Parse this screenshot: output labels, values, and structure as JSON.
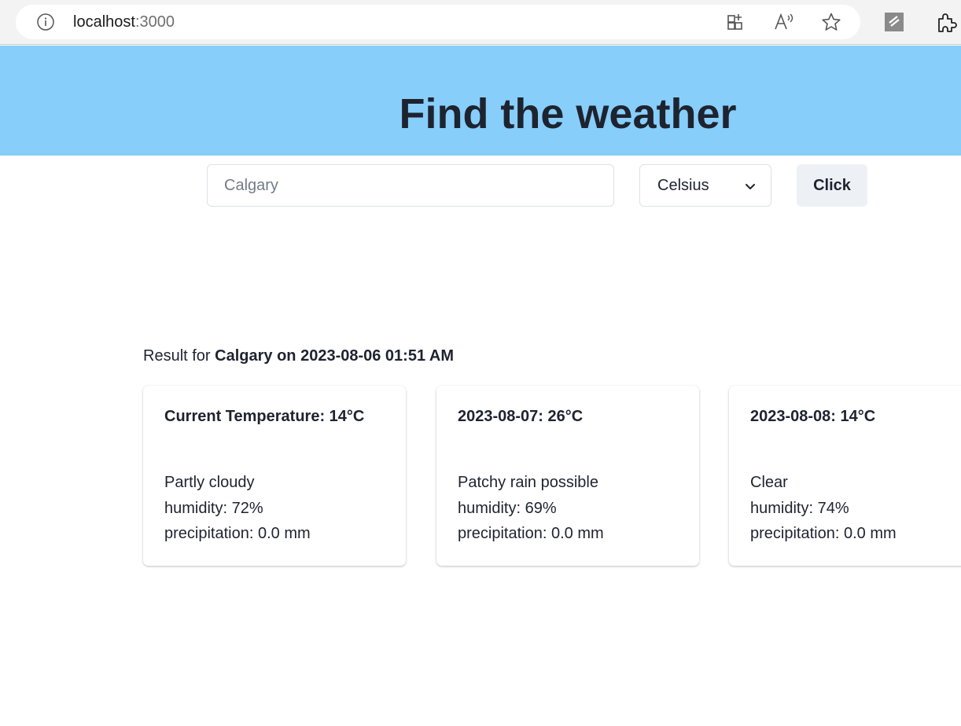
{
  "browser": {
    "url_host": "localhost",
    "url_port": ":3000",
    "icons": [
      "info-icon",
      "app-grid-icon",
      "read-aloud-icon",
      "favorite-star-icon",
      "extension-icon",
      "puzzle-icon"
    ]
  },
  "header": {
    "title": "Find the weather",
    "background_color": "#87cefa"
  },
  "search": {
    "placeholder": "Calgary",
    "value": "",
    "unit_selected": "Celsius",
    "submit_label": "Click"
  },
  "result": {
    "prefix": "Result for",
    "subject": "Calgary on 2023-08-06 01:51 AM"
  },
  "cards": [
    {
      "title": "Current Temperature: 14°C",
      "condition": "Partly cloudy",
      "humidity": "humidity: 72%",
      "precipitation": "precipitation: 0.0 mm"
    },
    {
      "title": "2023-08-07: 26°C",
      "condition": "Patchy rain possible",
      "humidity": "humidity: 69%",
      "precipitation": "precipitation: 0.0 mm"
    },
    {
      "title": "2023-08-08: 14°C",
      "condition": "Clear",
      "humidity": "humidity: 74%",
      "precipitation": "precipitation: 0.0 mm"
    }
  ]
}
